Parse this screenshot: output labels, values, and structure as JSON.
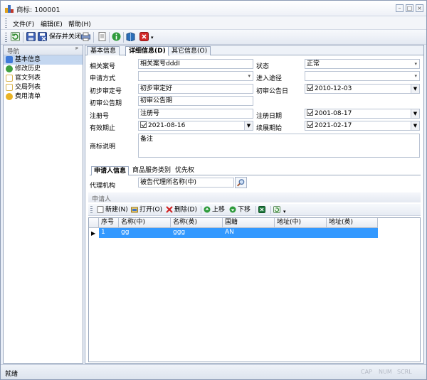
{
  "window": {
    "title": "商标: 100001"
  },
  "menu": [
    "文件(F)",
    "编辑(E)",
    "帮助(H)"
  ],
  "toolbar": {
    "save_close_label": "保存并关闭"
  },
  "nav": {
    "header": "导航",
    "pin": "ᵖ",
    "items": [
      {
        "label": "基本信息",
        "color": "#3f7ad8",
        "selected": true
      },
      {
        "label": "修改历史",
        "color": "#3f9f3f"
      },
      {
        "label": "官文列表",
        "color": "#d9b34a"
      },
      {
        "label": "交局列表",
        "color": "#d9b34a"
      },
      {
        "label": "费用清单",
        "color": "#e28d1b"
      }
    ]
  },
  "tabs": [
    "基本信息",
    "详细信息(D)",
    "其它信息(O)"
  ],
  "form": {
    "related_no_label": "相关案号",
    "related_no_value": "相关案号ddd",
    "status_label": "状态",
    "status_value": "正常",
    "apply_method_label": "申请方式",
    "apply_method_value": "",
    "entry_path_label": "进入途径",
    "entry_path_value": "",
    "prelim_no_label": "初步审定号",
    "prelim_no_value": "初步审定好",
    "prelim_pub_date_label": "初审公告日",
    "prelim_pub_date_value": "2010-12-03",
    "prelim_pub_period_label": "初审公告期",
    "prelim_pub_period_value": "初审公告期",
    "reg_no_label": "注册号",
    "reg_no_value": "注册号",
    "reg_date_label": "注册日期",
    "reg_date_value": "2001-08-17",
    "valid_until_label": "有效期止",
    "valid_until_value": "2021-08-16",
    "renew_start_label": "续展期始",
    "renew_start_value": "2021-02-17",
    "desc_label": "商标说明",
    "desc_value": "备注"
  },
  "subtabs": [
    "申请人信息",
    "商品服务类别",
    "优先权"
  ],
  "agent": {
    "label": "代理机构",
    "value": "被告代理所名称(中)"
  },
  "applicant_group": "申请人",
  "inner_toolbar": {
    "new": "新建(N)",
    "open": "打开(O)",
    "delete": "删除(D)",
    "up": "上移",
    "down": "下移"
  },
  "grid": {
    "columns": [
      "序号",
      "名称(中)",
      "名称(英)",
      "国籍",
      "地址(中)",
      "地址(英)"
    ],
    "rows": [
      [
        "1",
        "gg",
        "ggg",
        "AN",
        "",
        ""
      ]
    ]
  },
  "status": {
    "main": "就绪",
    "caps": "CAP",
    "num": "NUM",
    "scrl": "SCRL"
  }
}
